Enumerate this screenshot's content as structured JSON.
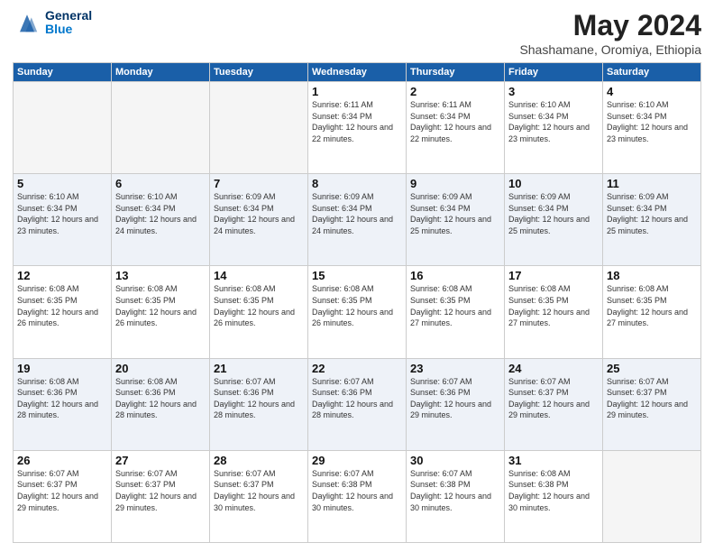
{
  "header": {
    "logo_line1": "General",
    "logo_line2": "Blue",
    "month_title": "May 2024",
    "subtitle": "Shashamane, Oromiya, Ethiopia"
  },
  "days_of_week": [
    "Sunday",
    "Monday",
    "Tuesday",
    "Wednesday",
    "Thursday",
    "Friday",
    "Saturday"
  ],
  "weeks": [
    [
      {
        "day": "",
        "sunrise": "",
        "sunset": "",
        "daylight": "",
        "empty": true
      },
      {
        "day": "",
        "sunrise": "",
        "sunset": "",
        "daylight": "",
        "empty": true
      },
      {
        "day": "",
        "sunrise": "",
        "sunset": "",
        "daylight": "",
        "empty": true
      },
      {
        "day": "1",
        "sunrise": "Sunrise: 6:11 AM",
        "sunset": "Sunset: 6:34 PM",
        "daylight": "Daylight: 12 hours and 22 minutes."
      },
      {
        "day": "2",
        "sunrise": "Sunrise: 6:11 AM",
        "sunset": "Sunset: 6:34 PM",
        "daylight": "Daylight: 12 hours and 22 minutes."
      },
      {
        "day": "3",
        "sunrise": "Sunrise: 6:10 AM",
        "sunset": "Sunset: 6:34 PM",
        "daylight": "Daylight: 12 hours and 23 minutes."
      },
      {
        "day": "4",
        "sunrise": "Sunrise: 6:10 AM",
        "sunset": "Sunset: 6:34 PM",
        "daylight": "Daylight: 12 hours and 23 minutes."
      }
    ],
    [
      {
        "day": "5",
        "sunrise": "Sunrise: 6:10 AM",
        "sunset": "Sunset: 6:34 PM",
        "daylight": "Daylight: 12 hours and 23 minutes."
      },
      {
        "day": "6",
        "sunrise": "Sunrise: 6:10 AM",
        "sunset": "Sunset: 6:34 PM",
        "daylight": "Daylight: 12 hours and 24 minutes."
      },
      {
        "day": "7",
        "sunrise": "Sunrise: 6:09 AM",
        "sunset": "Sunset: 6:34 PM",
        "daylight": "Daylight: 12 hours and 24 minutes."
      },
      {
        "day": "8",
        "sunrise": "Sunrise: 6:09 AM",
        "sunset": "Sunset: 6:34 PM",
        "daylight": "Daylight: 12 hours and 24 minutes."
      },
      {
        "day": "9",
        "sunrise": "Sunrise: 6:09 AM",
        "sunset": "Sunset: 6:34 PM",
        "daylight": "Daylight: 12 hours and 25 minutes."
      },
      {
        "day": "10",
        "sunrise": "Sunrise: 6:09 AM",
        "sunset": "Sunset: 6:34 PM",
        "daylight": "Daylight: 12 hours and 25 minutes."
      },
      {
        "day": "11",
        "sunrise": "Sunrise: 6:09 AM",
        "sunset": "Sunset: 6:34 PM",
        "daylight": "Daylight: 12 hours and 25 minutes."
      }
    ],
    [
      {
        "day": "12",
        "sunrise": "Sunrise: 6:08 AM",
        "sunset": "Sunset: 6:35 PM",
        "daylight": "Daylight: 12 hours and 26 minutes."
      },
      {
        "day": "13",
        "sunrise": "Sunrise: 6:08 AM",
        "sunset": "Sunset: 6:35 PM",
        "daylight": "Daylight: 12 hours and 26 minutes."
      },
      {
        "day": "14",
        "sunrise": "Sunrise: 6:08 AM",
        "sunset": "Sunset: 6:35 PM",
        "daylight": "Daylight: 12 hours and 26 minutes."
      },
      {
        "day": "15",
        "sunrise": "Sunrise: 6:08 AM",
        "sunset": "Sunset: 6:35 PM",
        "daylight": "Daylight: 12 hours and 26 minutes."
      },
      {
        "day": "16",
        "sunrise": "Sunrise: 6:08 AM",
        "sunset": "Sunset: 6:35 PM",
        "daylight": "Daylight: 12 hours and 27 minutes."
      },
      {
        "day": "17",
        "sunrise": "Sunrise: 6:08 AM",
        "sunset": "Sunset: 6:35 PM",
        "daylight": "Daylight: 12 hours and 27 minutes."
      },
      {
        "day": "18",
        "sunrise": "Sunrise: 6:08 AM",
        "sunset": "Sunset: 6:35 PM",
        "daylight": "Daylight: 12 hours and 27 minutes."
      }
    ],
    [
      {
        "day": "19",
        "sunrise": "Sunrise: 6:08 AM",
        "sunset": "Sunset: 6:36 PM",
        "daylight": "Daylight: 12 hours and 28 minutes."
      },
      {
        "day": "20",
        "sunrise": "Sunrise: 6:08 AM",
        "sunset": "Sunset: 6:36 PM",
        "daylight": "Daylight: 12 hours and 28 minutes."
      },
      {
        "day": "21",
        "sunrise": "Sunrise: 6:07 AM",
        "sunset": "Sunset: 6:36 PM",
        "daylight": "Daylight: 12 hours and 28 minutes."
      },
      {
        "day": "22",
        "sunrise": "Sunrise: 6:07 AM",
        "sunset": "Sunset: 6:36 PM",
        "daylight": "Daylight: 12 hours and 28 minutes."
      },
      {
        "day": "23",
        "sunrise": "Sunrise: 6:07 AM",
        "sunset": "Sunset: 6:36 PM",
        "daylight": "Daylight: 12 hours and 29 minutes."
      },
      {
        "day": "24",
        "sunrise": "Sunrise: 6:07 AM",
        "sunset": "Sunset: 6:37 PM",
        "daylight": "Daylight: 12 hours and 29 minutes."
      },
      {
        "day": "25",
        "sunrise": "Sunrise: 6:07 AM",
        "sunset": "Sunset: 6:37 PM",
        "daylight": "Daylight: 12 hours and 29 minutes."
      }
    ],
    [
      {
        "day": "26",
        "sunrise": "Sunrise: 6:07 AM",
        "sunset": "Sunset: 6:37 PM",
        "daylight": "Daylight: 12 hours and 29 minutes."
      },
      {
        "day": "27",
        "sunrise": "Sunrise: 6:07 AM",
        "sunset": "Sunset: 6:37 PM",
        "daylight": "Daylight: 12 hours and 29 minutes."
      },
      {
        "day": "28",
        "sunrise": "Sunrise: 6:07 AM",
        "sunset": "Sunset: 6:37 PM",
        "daylight": "Daylight: 12 hours and 30 minutes."
      },
      {
        "day": "29",
        "sunrise": "Sunrise: 6:07 AM",
        "sunset": "Sunset: 6:38 PM",
        "daylight": "Daylight: 12 hours and 30 minutes."
      },
      {
        "day": "30",
        "sunrise": "Sunrise: 6:07 AM",
        "sunset": "Sunset: 6:38 PM",
        "daylight": "Daylight: 12 hours and 30 minutes."
      },
      {
        "day": "31",
        "sunrise": "Sunrise: 6:08 AM",
        "sunset": "Sunset: 6:38 PM",
        "daylight": "Daylight: 12 hours and 30 minutes."
      },
      {
        "day": "",
        "sunrise": "",
        "sunset": "",
        "daylight": "",
        "empty": true
      }
    ]
  ]
}
